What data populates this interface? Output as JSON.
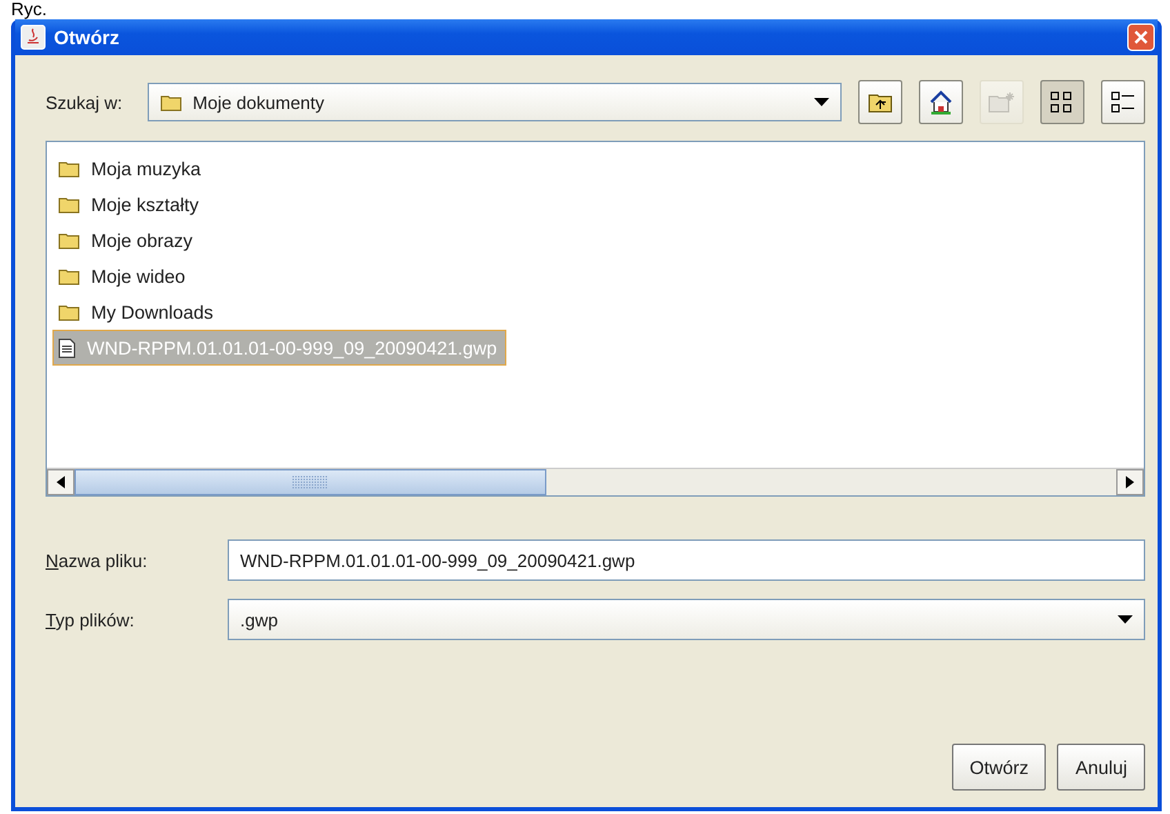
{
  "caption": "Ryc.",
  "window": {
    "title": "Otwórz"
  },
  "look_in": {
    "label": "Szukaj w:",
    "value": "Moje dokumenty"
  },
  "toolbar": [
    {
      "kind": "up",
      "disabled": false,
      "selected": false
    },
    {
      "kind": "home",
      "disabled": false,
      "selected": false
    },
    {
      "kind": "newfolder",
      "disabled": true,
      "selected": false
    },
    {
      "kind": "list",
      "disabled": false,
      "selected": true
    },
    {
      "kind": "details",
      "disabled": false,
      "selected": false
    }
  ],
  "files": [
    {
      "kind": "folder",
      "name": "Moja muzyka",
      "selected": false
    },
    {
      "kind": "folder",
      "name": "Moje kształty",
      "selected": false
    },
    {
      "kind": "folder",
      "name": "Moje obrazy",
      "selected": false
    },
    {
      "kind": "folder",
      "name": "Moje wideo",
      "selected": false
    },
    {
      "kind": "folder",
      "name": "My Downloads",
      "selected": false
    },
    {
      "kind": "file",
      "name": "WND-RPPM.01.01.01-00-999_09_20090421.gwp",
      "selected": true
    }
  ],
  "file_name": {
    "label": "Nazwa pliku:",
    "mnemonic": true,
    "value": "WND-RPPM.01.01.01-00-999_09_20090421.gwp"
  },
  "file_type": {
    "label": "Typ plików:",
    "mnemonic": true,
    "value": ".gwp"
  },
  "buttons": [
    "Otwórz",
    "Anuluj"
  ]
}
